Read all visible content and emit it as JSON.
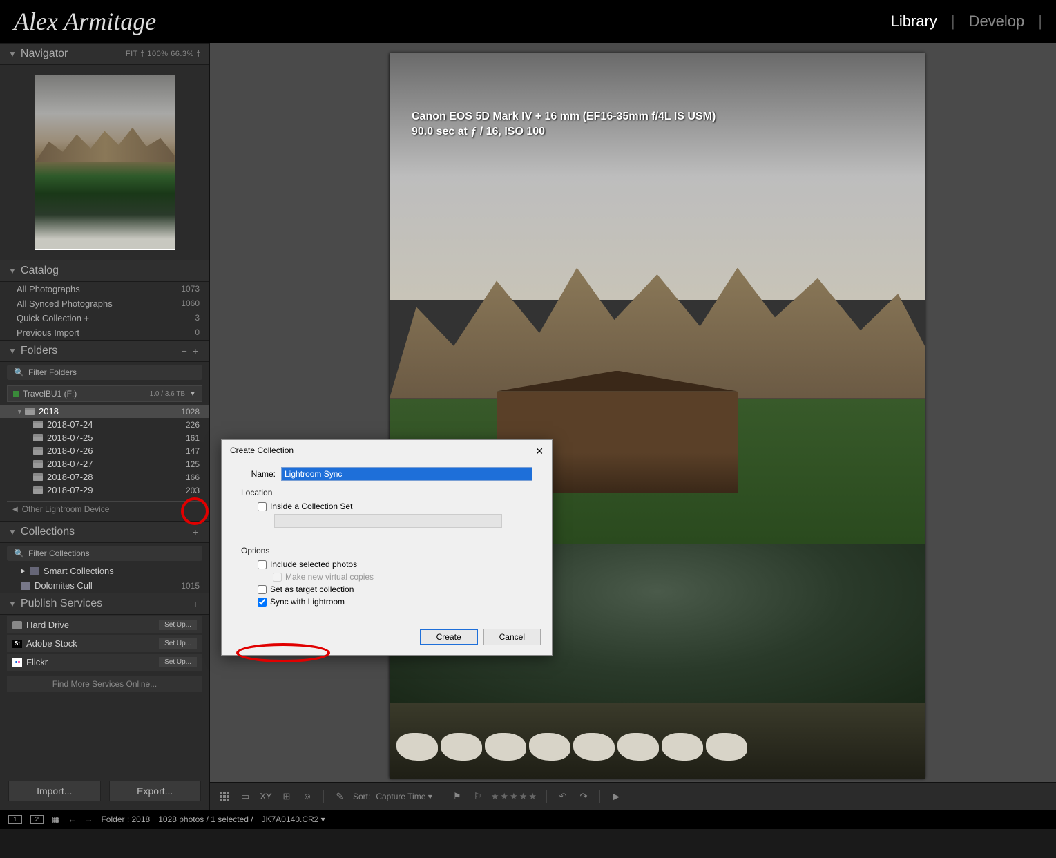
{
  "brand": "Alex Armitage",
  "modules": {
    "library": "Library",
    "develop": "Develop"
  },
  "navigator": {
    "title": "Navigator",
    "zoom": "FIT ‡   100%    66.3% ‡"
  },
  "catalog": {
    "title": "Catalog",
    "rows": [
      {
        "label": "All Photographs",
        "count": "1073"
      },
      {
        "label": "All Synced Photographs",
        "count": "1060"
      },
      {
        "label": "Quick Collection  +",
        "count": "3"
      },
      {
        "label": "Previous Import",
        "count": "0"
      }
    ]
  },
  "folders": {
    "title": "Folders",
    "filter": "Filter Folders",
    "drive": {
      "label": "TravelBU1 (F:)",
      "cap": "1.0 / 3.6 TB"
    },
    "root": {
      "label": "2018",
      "count": "1028"
    },
    "children": [
      {
        "label": "2018-07-24",
        "count": "226"
      },
      {
        "label": "2018-07-25",
        "count": "161"
      },
      {
        "label": "2018-07-26",
        "count": "147"
      },
      {
        "label": "2018-07-27",
        "count": "125"
      },
      {
        "label": "2018-07-28",
        "count": "166"
      },
      {
        "label": "2018-07-29",
        "count": "203"
      }
    ],
    "other": "Other Lightroom Device"
  },
  "collections": {
    "title": "Collections",
    "filter": "Filter Collections",
    "rows": [
      {
        "label": "Smart Collections",
        "count": ""
      },
      {
        "label": "Dolomites Cull",
        "count": "1015"
      }
    ]
  },
  "publish": {
    "title": "Publish Services",
    "rows": [
      {
        "label": "Hard Drive",
        "setup": "Set Up..."
      },
      {
        "label": "Adobe Stock",
        "setup": "Set Up..."
      },
      {
        "label": "Flickr",
        "setup": "Set Up..."
      }
    ],
    "findmore": "Find More Services Online..."
  },
  "left_buttons": {
    "import": "Import...",
    "export": "Export..."
  },
  "meta": {
    "line1": "Canon EOS 5D Mark IV + 16 mm (EF16-35mm f/4L IS USM)",
    "line2": "90.0 sec at ƒ / 16, ISO 100"
  },
  "toolbar": {
    "sort_label": "Sort:",
    "sort_value": "Capture Time"
  },
  "status": {
    "screen1": "1",
    "screen2": "2",
    "folder": "Folder : 2018",
    "counts": "1028 photos / 1 selected /",
    "filename": "JK7A0140.CR2"
  },
  "dialog": {
    "title": "Create Collection",
    "name_label": "Name:",
    "name_value": "Lightroom Sync",
    "location_label": "Location",
    "inside_set": "Inside a Collection Set",
    "options_label": "Options",
    "include_photos": "Include selected photos",
    "virtual_copies": "Make new virtual copies",
    "set_target": "Set as target collection",
    "sync_cc": "Sync with Lightroom",
    "create": "Create",
    "cancel": "Cancel"
  }
}
